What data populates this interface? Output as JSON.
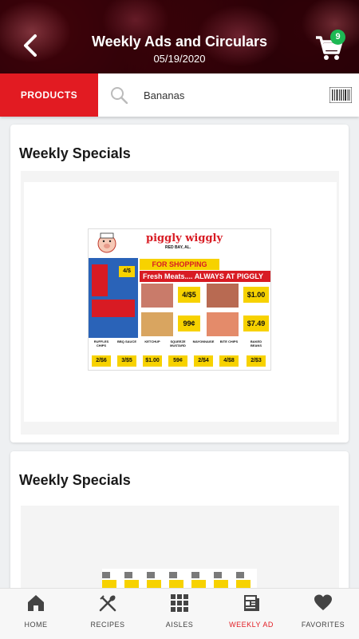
{
  "header": {
    "title": "Weekly Ads and Circulars",
    "date": "05/19/2020",
    "cart_count": "9",
    "back_icon": "chevron-left-icon",
    "cart_icon": "cart-icon"
  },
  "search": {
    "products_label": "PRODUCTS",
    "value": "Bananas",
    "search_icon": "search-icon",
    "barcode_icon": "barcode-icon"
  },
  "sections": [
    {
      "title": "Weekly Specials"
    },
    {
      "title": "Weekly Specials"
    }
  ],
  "flyer": {
    "store_name": "piggly wiggly",
    "location": "RED BAY, AL.",
    "promo": "FOR SHOPPING",
    "meats_banner": "Fresh Meats.... ALWAYS AT PIGGLY WIGGLY",
    "prices": [
      "4/$5",
      "$1.00",
      "99¢",
      "$7.49"
    ],
    "bottom_items": [
      {
        "label": "RUFFLES CHIPS",
        "price": "2/$6"
      },
      {
        "label": "BBQ SAUCE",
        "price": "3/$5"
      },
      {
        "label": "KETCHUP",
        "price": "$1.00"
      },
      {
        "label": "SQUEEZE MUSTARD",
        "price": "59¢"
      },
      {
        "label": "MAYONNAISE",
        "price": "2/$4"
      },
      {
        "label": "BITE CHIPS",
        "price": "4/$8"
      },
      {
        "label": "BAKED BEANS",
        "price": "2/$3"
      }
    ]
  },
  "tabs": [
    {
      "label": "HOME",
      "icon": "home-icon"
    },
    {
      "label": "RECIPES",
      "icon": "utensils-icon"
    },
    {
      "label": "AISLES",
      "icon": "grid-icon"
    },
    {
      "label": "WEEKLY AD",
      "icon": "newspaper-icon"
    },
    {
      "label": "FAVORITES",
      "icon": "heart-icon"
    }
  ],
  "colors": {
    "accent": "#e21b22",
    "badge": "#1db954"
  }
}
